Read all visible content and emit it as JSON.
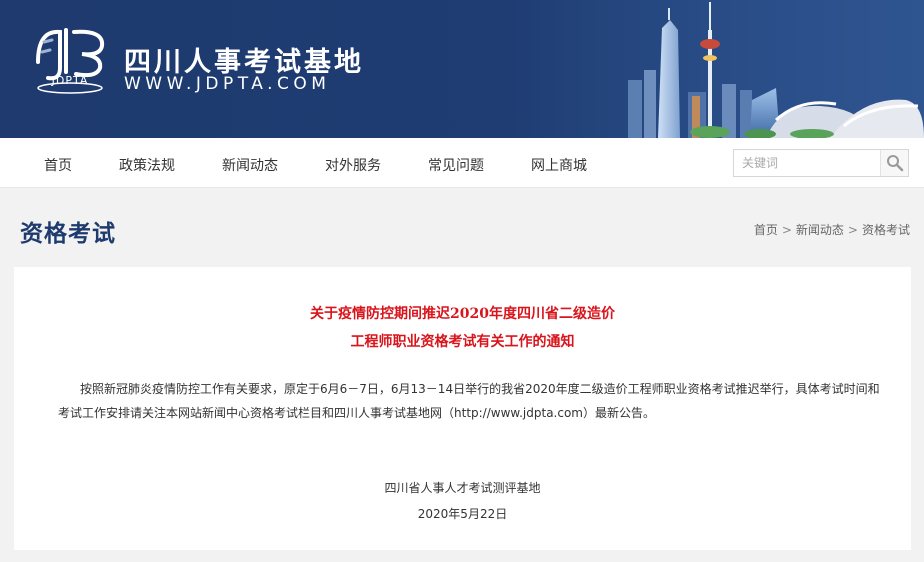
{
  "header": {
    "logo_text": "JDPTA",
    "site_name": "四川人事考试基地",
    "site_url": "WWW.JDPTA.COM"
  },
  "nav": {
    "items": [
      {
        "label": "首页"
      },
      {
        "label": "政策法规"
      },
      {
        "label": "新闻动态"
      },
      {
        "label": "对外服务"
      },
      {
        "label": "常见问题"
      },
      {
        "label": "网上商城"
      }
    ],
    "search_placeholder": "关键词"
  },
  "page": {
    "section_title": "资格考试",
    "breadcrumb": [
      "首页",
      "新闻动态",
      "资格考试"
    ],
    "breadcrumb_separator": ">"
  },
  "article": {
    "title_line1": "关于疫情防控期间推迟2020年度四川省二级造价",
    "title_line2": "工程师职业资格考试有关工作的通知",
    "body_line1": "按照新冠肺炎疫情防控工作有关要求，原定于6月6－7日，6月13－14日举行的我省2020年度二级造价工程师职业资格考试推迟举行，具体考试时间和",
    "body_line2": "考试工作安排请关注本网站新闻中心资格考试栏目和四川人事考试基地网（http://www.jdpta.com）最新公告。",
    "signature": "四川省人事人才考试测评基地",
    "date": "2020年5月22日"
  },
  "colors": {
    "header_bg": "#1e3a6e",
    "title_red": "#d9141b",
    "section_blue": "#1e3a6e"
  }
}
